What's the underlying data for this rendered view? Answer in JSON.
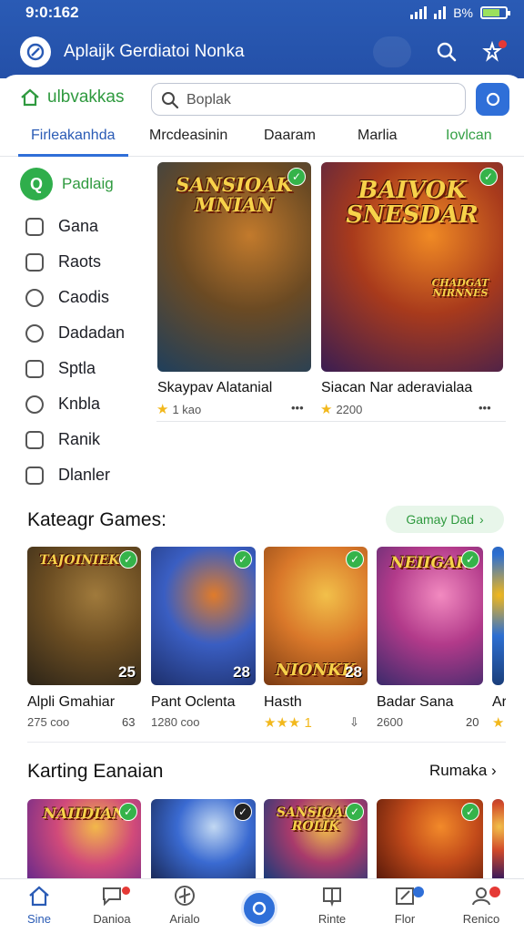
{
  "status": {
    "time": "9:0:162",
    "signal_text": "B%"
  },
  "header": {
    "title": "Aplaijk Gerdiatoi Nonka"
  },
  "brand": {
    "label": "ulbvakkas"
  },
  "search": {
    "placeholder": "Boplak"
  },
  "tabs": [
    "Firleakanhda",
    "Mrcdeasinin",
    "Daaram",
    "Marlia",
    "Iovlcan"
  ],
  "sidebar": {
    "active": "Padlaig",
    "items": [
      "Gana",
      "Raots",
      "Caodis",
      "Dadadan",
      "Sptla",
      "Knbla",
      "Ranik",
      "Dlanler"
    ]
  },
  "featured": [
    {
      "art": "SANSIOAK MNIAN",
      "title": "Skaypav Alatanial",
      "rating": "1 kao",
      "extra": "•••",
      "colors": [
        "#1f3f5c",
        "#6b4a23",
        "#c27a2c"
      ]
    },
    {
      "art": "BAIVOK SNESDAR",
      "badge": "CHADGAT NIRNNES",
      "title": "Siacan Nar aderavialaa",
      "rating": "2200",
      "extra": "•••",
      "colors": [
        "#3a1d52",
        "#a83a1c",
        "#f08a24"
      ]
    }
  ],
  "section1": {
    "title": "Kateagr Games:",
    "pill": "Gamay Dad"
  },
  "games": [
    {
      "art": "TAJOINIEKT",
      "score": "25",
      "title": "Alpli Gmahiar",
      "meta": "275 coo",
      "extra": "63",
      "colors": [
        "#2c2418",
        "#6b4d22",
        "#a07a3c"
      ]
    },
    {
      "art": "",
      "score": "28",
      "title": "Pant Oclenta",
      "meta": "1280 coo",
      "extra": "",
      "colors": [
        "#1d2f6b",
        "#3a5ec2",
        "#e07b2a"
      ]
    },
    {
      "art": "NIONKK",
      "score": "28",
      "title": "Hasth",
      "meta": "★★★ 1",
      "extra": "",
      "colors": [
        "#7a3a12",
        "#d9782a",
        "#f2c04a"
      ]
    },
    {
      "art": "NEIIGAK",
      "score": "",
      "title": "Badar Sana",
      "meta": "2600",
      "extra": "20",
      "colors": [
        "#3b2a6b",
        "#b23a8a",
        "#f28ac0"
      ]
    },
    {
      "art": "",
      "score": "",
      "title": "Ar",
      "meta": "★",
      "extra": "",
      "colors": [
        "#1a3e7a",
        "#2d6fd1",
        "#f2b81c"
      ]
    }
  ],
  "section2": {
    "title": "Karting Eanaian",
    "more": "Rumaka"
  },
  "bottom_cards": [
    {
      "art": "NAIIDIAN",
      "colors": [
        "#6b2a8a",
        "#d14a7a",
        "#f2b84a"
      ]
    },
    {
      "art": "",
      "colors": [
        "#1a2a5a",
        "#3a6ad1",
        "#c2d8f2"
      ]
    },
    {
      "art": "SANSIOAN ROLIK",
      "colors": [
        "#1a3a7a",
        "#a83a6b",
        "#f2c04a"
      ]
    },
    {
      "art": "",
      "colors": [
        "#5a1a0a",
        "#c24a1a",
        "#f28a2a"
      ]
    },
    {
      "art": "",
      "colors": [
        "#3a1a5a",
        "#d14a2a",
        "#f2c04a"
      ]
    }
  ],
  "bottom_nav": [
    {
      "label": "Sine",
      "icon": "home-icon"
    },
    {
      "label": "Danioa",
      "icon": "chat-icon"
    },
    {
      "label": "Arialo",
      "icon": "compass-icon"
    },
    {
      "label": "",
      "icon": "center-action-icon"
    },
    {
      "label": "Rinte",
      "icon": "book-icon"
    },
    {
      "label": "Flor",
      "icon": "edit-icon"
    },
    {
      "label": "Renico",
      "icon": "profile-icon"
    }
  ],
  "theme": {
    "primary": "#2a5bb5",
    "accent_green": "#2fae4b",
    "star": "#f2b81c"
  }
}
